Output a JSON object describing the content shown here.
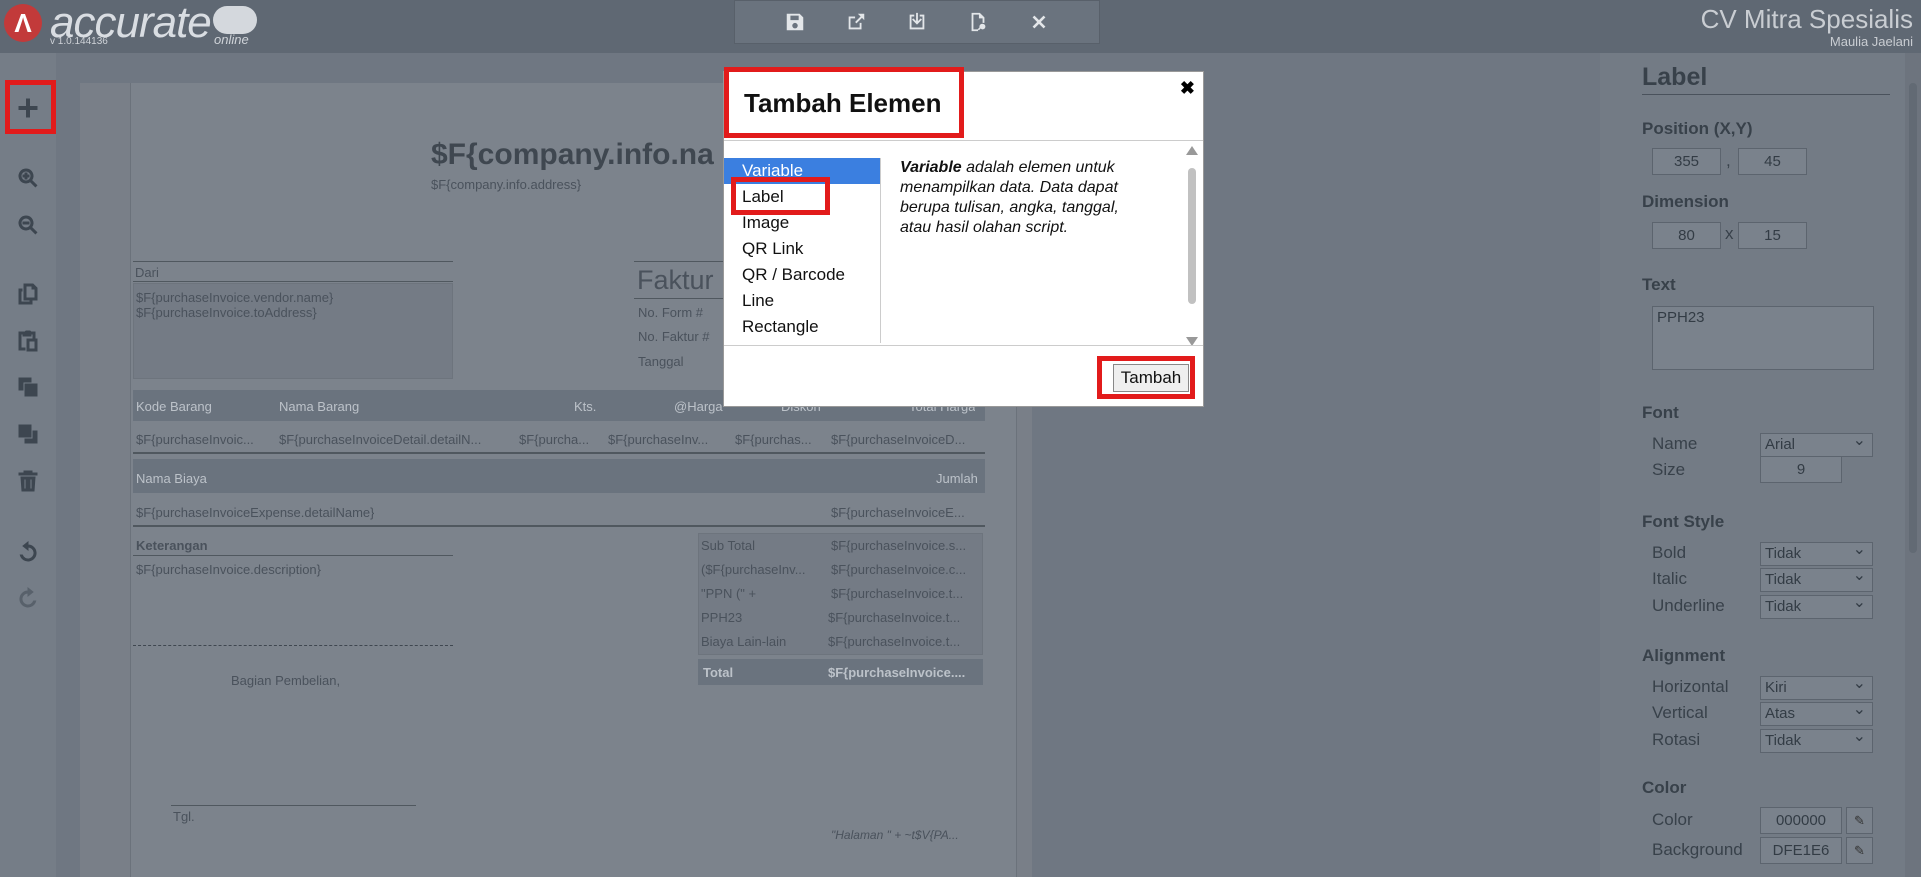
{
  "app": {
    "logo_text": "accurate",
    "logo_sub": "online",
    "version": "v 1.0.144136",
    "company": "CV Mitra Spesialis",
    "user": "Maulia Jaelani"
  },
  "toolbar": {
    "icons": [
      "save-icon",
      "export-icon",
      "import-icon",
      "preview-icon",
      "close-icon"
    ]
  },
  "leftrail": {
    "icons": [
      "add-icon",
      "zoom-in-icon",
      "zoom-out-icon",
      "copy-icon",
      "paste-icon",
      "bring-front-icon",
      "send-back-icon",
      "delete-icon",
      "undo-icon",
      "redo-icon"
    ]
  },
  "paper": {
    "company_name": "$F{company.info.na",
    "company_address": "$F{company.info.address}",
    "dari": "Dari",
    "vendor": "$F{purchaseInvoice.vendor.name}",
    "to_address": "$F{purchaseInvoice.toAddress}",
    "faktur": "Faktur",
    "no_form": "No. Form #",
    "no_faktur": "No. Faktur #",
    "tanggal": "Tanggal",
    "cols": [
      "Kode Barang",
      "Nama Barang",
      "Kts.",
      "@Harga",
      "Diskon",
      "Total Harga"
    ],
    "row": [
      "$F{purchaseInvoic...",
      "$F{purchaseInvoiceDetail.detailN...",
      "$F{purcha...",
      "$F{purchaseInv...",
      "$F{purchas...",
      "$F{purchaseInvoiceD..."
    ],
    "nama_biaya": "Nama Biaya",
    "jumlah": "Jumlah",
    "expense_name": "$F{purchaseInvoiceExpense.detailName}",
    "expense_amount": "$F{purchaseInvoiceE...",
    "keterangan": "Keterangan",
    "description": "$F{purchaseInvoice.description}",
    "sub_total": "Sub Total",
    "sub_total_v": "$F{purchaseInvoice.s...",
    "diskon_l": "($F{purchaseInv...",
    "diskon_v": "$F{purchaseInvoice.c...",
    "ppn_l": "\"PPN (\" +",
    "ppn_v": "$F{purchaseInvoice.t...",
    "pph_l": "PPH23",
    "pph_v": "$F{purchaseInvoice.t...",
    "biaya_l": "Biaya Lain-lain",
    "biaya_v": "$F{purchaseInvoice.t...",
    "total_l": "Total",
    "total_v": "$F{purchaseInvoice....",
    "bagian": "Bagian Pembelian,",
    "tgl": "Tgl.",
    "halaman": "\"Halaman \" +  ~t$V{PA..."
  },
  "dialog": {
    "title": "Tambah Elemen",
    "items": [
      "Variable",
      "Label",
      "Image",
      "QR Link",
      "QR / Barcode",
      "Line",
      "Rectangle"
    ],
    "selected": "Variable",
    "desc_bold": "Variable",
    "desc_rest": " adalah elemen untuk menampilkan data. Data dapat berupa tulisan, angka, tanggal, atau hasil olahan script.",
    "add_button": "Tambah"
  },
  "panel": {
    "title": "Label",
    "position_label": "Position (X,Y)",
    "pos_x": "355",
    "pos_y": "45",
    "dimension_label": "Dimension",
    "dim_w": "80",
    "dim_x": "x",
    "dim_h": "15",
    "pos_sep": ",",
    "text_label": "Text",
    "text_value": "PPH23",
    "font_label": "Font",
    "name_label": "Name",
    "name_value": "Arial",
    "size_label": "Size",
    "size_value": "9",
    "font_style_label": "Font Style",
    "bold_label": "Bold",
    "bold_value": "Tidak",
    "italic_label": "Italic",
    "italic_value": "Tidak",
    "underline_label": "Underline",
    "underline_value": "Tidak",
    "alignment_label": "Alignment",
    "horizontal_label": "Horizontal",
    "horizontal_value": "Kiri",
    "vertical_label": "Vertical",
    "vertical_value": "Atas",
    "rotasi_label": "Rotasi",
    "rotasi_value": "Tidak",
    "color_section": "Color",
    "color_label": "Color",
    "color_value": "000000",
    "background_label": "Background",
    "background_value": "DFE1E6"
  },
  "colors": {
    "highlight": "#e21b1b",
    "selection": "#3b7fe0"
  }
}
